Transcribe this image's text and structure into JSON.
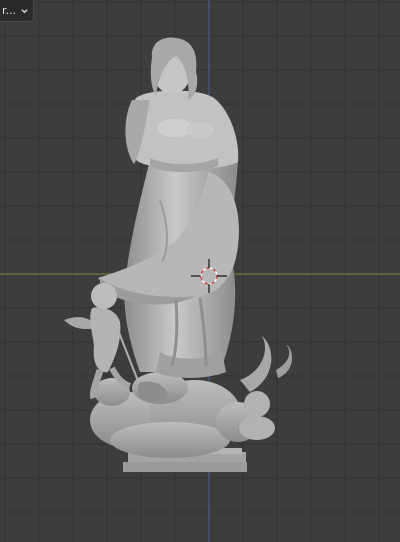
{
  "viewport": {
    "mode_label": "r...",
    "mode_icon": "chevron-down-icon",
    "background_color": "#3d3d3d",
    "grid_color": "#353535",
    "x_axis_color": "#7a9a3c",
    "z_axis_color": "#3f5f9e",
    "model_color": "#b8b8b8",
    "cursor_icon": "3d-cursor-icon"
  }
}
